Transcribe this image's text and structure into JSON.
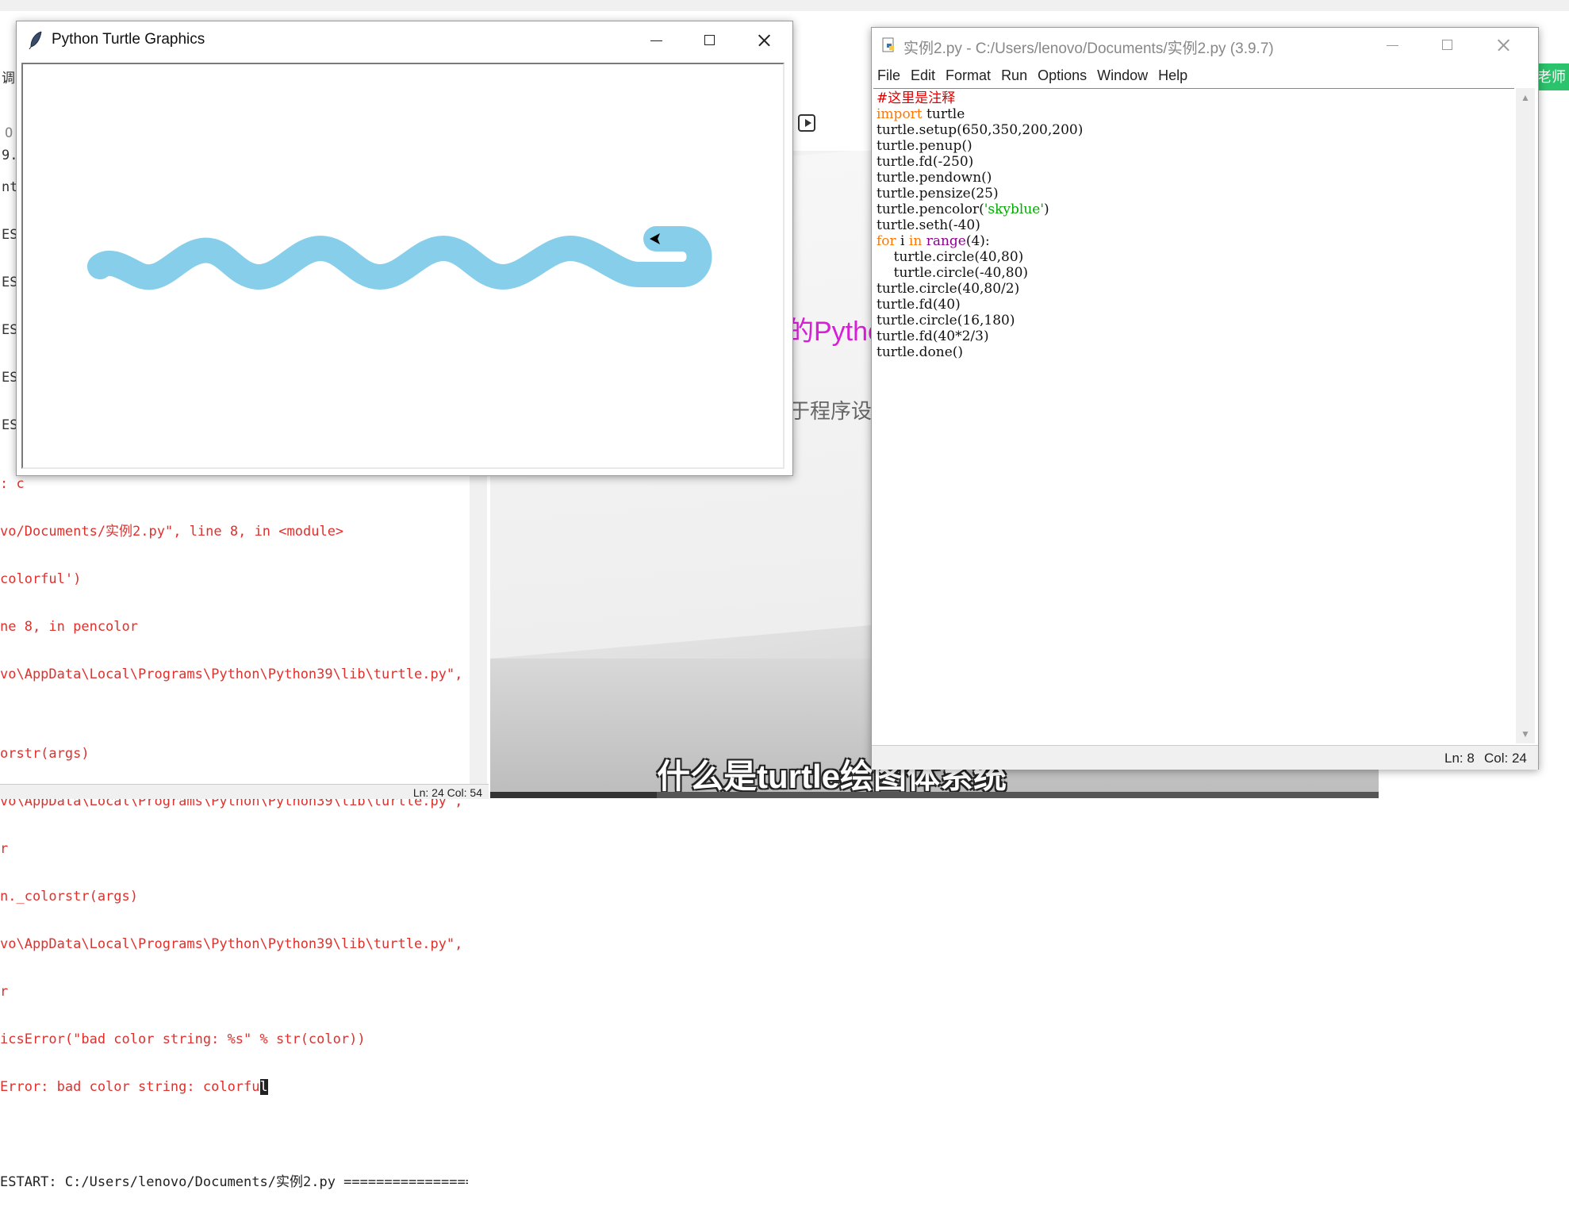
{
  "turtle_window": {
    "title": "Python Turtle Graphics",
    "pen_color": "#87ceeb",
    "pen_size": 25
  },
  "idle_window": {
    "title": "实例2.py - C:/Users/lenovo/Documents/实例2.py (3.9.7)",
    "menu": [
      "File",
      "Edit",
      "Format",
      "Run",
      "Options",
      "Window",
      "Help"
    ],
    "status": {
      "line": "Ln: 8",
      "col": "Col: 24"
    }
  },
  "code_lines": [
    "#这里是注释",
    "import turtle",
    "turtle.setup(650,350,200,200)",
    "turtle.penup()",
    "turtle.fd(-250)",
    "turtle.pendown()",
    "turtle.pensize(25)",
    "turtle.pencolor('skyblue')",
    "turtle.seth(-40)",
    "for i in range(4):",
    "    turtle.circle(40,80)",
    "    turtle.circle(-40,80)",
    "turtle.circle(40,80/2)",
    "turtle.fd(40)",
    "turtle.circle(16,180)",
    "turtle.fd(40*2/3)",
    "turtle.done()"
  ],
  "shell": {
    "side_fragments": [
      "调",
      "O",
      "9.",
      "nt^",
      "EST",
      "EST",
      "EST",
      "EST",
      "EST"
    ],
    "output_lines": [
      ": c",
      "vo/Documents/实例2.py\", line 8, in <module>",
      "colorful')",
      "ne 8, in pencolor",
      "vo\\AppData\\Local\\Programs\\Python\\Python39\\lib\\turtle.py\", l",
      "",
      "orstr(args)",
      "vo\\AppData\\Local\\Programs\\Python\\Python39\\lib\\turtle.py\", l",
      "r",
      "n._colorstr(args)",
      "vo\\AppData\\Local\\Programs\\Python\\Python39\\lib\\turtle.py\", l",
      "r",
      "icsError(\"bad color string: %s\" % str(color))",
      "Error: bad color string: colorfu"
    ],
    "caret_char": "l",
    "restart_line": "ESTART: C:/Users/lenovo/Documents/实例2.py ================",
    "status": "Ln: 24  Col: 54"
  },
  "video": {
    "python_text": "的Pytho",
    "cn_text": "于程序设",
    "subtitle": "什么是turtle绘图体系统",
    "badge_text": "老师"
  }
}
